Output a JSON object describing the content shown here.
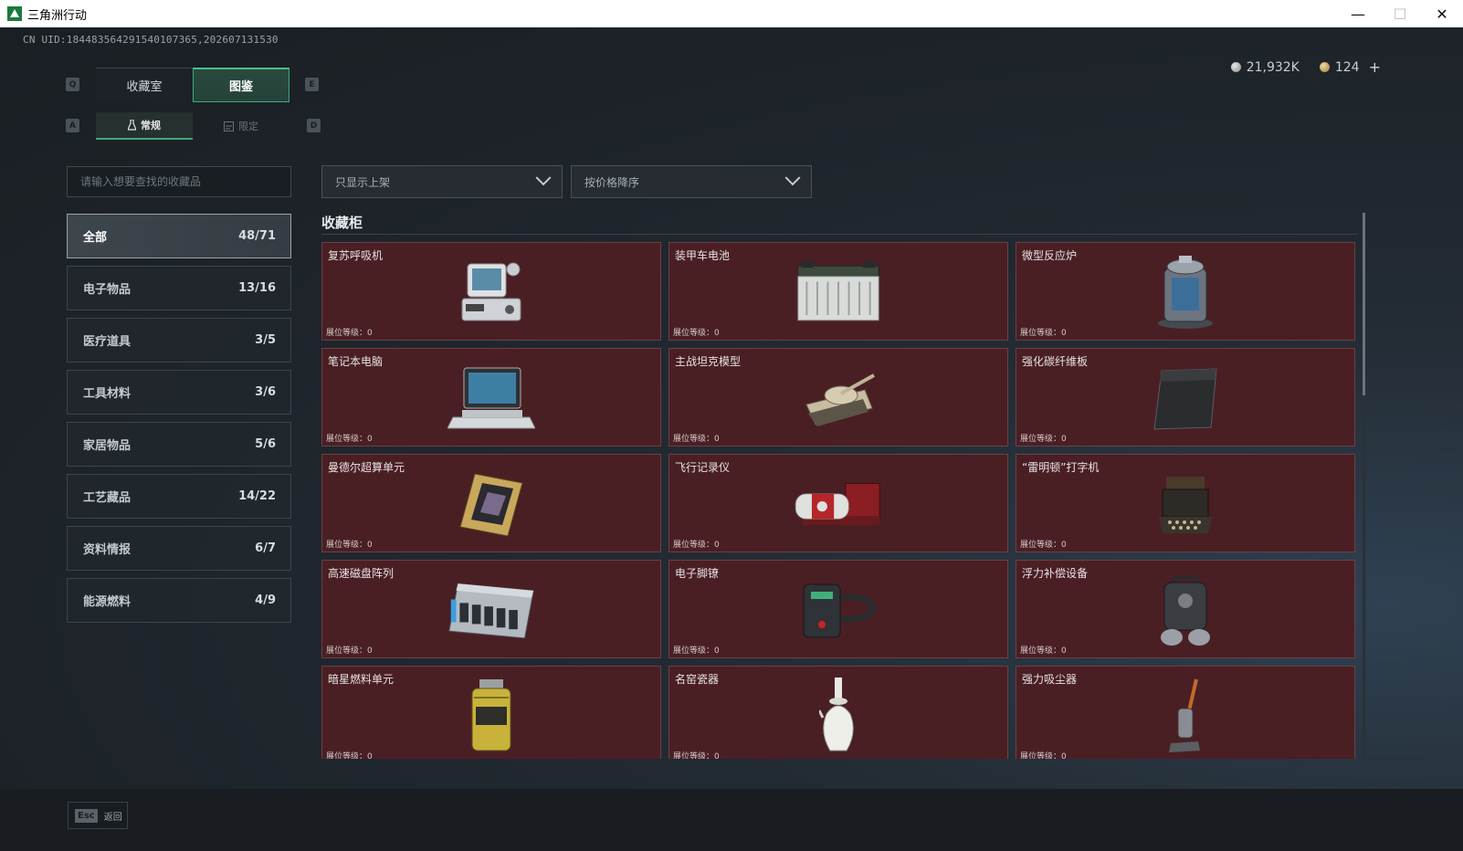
{
  "window": {
    "title": "三角洲行动",
    "minimize": "—",
    "maximize": "☐",
    "close": "✕"
  },
  "uid": "CN UID:18448356429154010736​5,202607131530",
  "currency": {
    "silver": "21,932K",
    "gold": "124",
    "add": "+"
  },
  "keys": {
    "prev_tab": "Q",
    "next_tab": "E",
    "prev_sub": "A",
    "next_sub": "D"
  },
  "tabs": [
    {
      "label": "收藏室",
      "active": false
    },
    {
      "label": "图鉴",
      "active": true
    }
  ],
  "subtabs": [
    {
      "label": "常规",
      "active": true
    },
    {
      "label": "限定",
      "active": false
    }
  ],
  "search": {
    "placeholder": "请输入想要查找的收藏品",
    "value": ""
  },
  "filters": {
    "display": "只显示上架",
    "sort": "按价格降序"
  },
  "categories": [
    {
      "label": "全部",
      "count": "48/71",
      "active": true
    },
    {
      "label": "电子物品",
      "count": "13/16",
      "active": false
    },
    {
      "label": "医疗道具",
      "count": "3/5",
      "active": false
    },
    {
      "label": "工具材料",
      "count": "3/6",
      "active": false
    },
    {
      "label": "家居物品",
      "count": "5/6",
      "active": false
    },
    {
      "label": "工艺藏品",
      "count": "14/22",
      "active": false
    },
    {
      "label": "资料情报",
      "count": "6/7",
      "active": false
    },
    {
      "label": "能源燃料",
      "count": "4/9",
      "active": false
    }
  ],
  "section_title": "收藏柜",
  "items": [
    {
      "name": "复苏呼吸机",
      "level": "展位等级：0",
      "icon": "ventilator-icon"
    },
    {
      "name": "装甲车电池",
      "level": "展位等级：0",
      "icon": "battery-icon"
    },
    {
      "name": "微型反应炉",
      "level": "展位等级：0",
      "icon": "reactor-icon"
    },
    {
      "name": "笔记本电脑",
      "level": "展位等级：0",
      "icon": "laptop-icon"
    },
    {
      "name": "主战坦克模型",
      "level": "展位等级：0",
      "icon": "tank-icon"
    },
    {
      "name": "强化碳纤维板",
      "level": "展位等级：0",
      "icon": "carbon-plate-icon"
    },
    {
      "name": "曼德尔超算单元",
      "level": "展位等级：0",
      "icon": "chip-icon"
    },
    {
      "name": "飞行记录仪",
      "level": "展位等级：0",
      "icon": "flight-recorder-icon"
    },
    {
      "name": "“雷明顿”打字机",
      "level": "展位等级：0",
      "icon": "typewriter-icon"
    },
    {
      "name": "高速磁盘阵列",
      "level": "展位等级：0",
      "icon": "disk-array-icon"
    },
    {
      "name": "电子脚镣",
      "level": "展位等级：0",
      "icon": "ankle-monitor-icon"
    },
    {
      "name": "浮力补偿设备",
      "level": "展位等级：0",
      "icon": "buoyancy-device-icon"
    },
    {
      "name": "暗星燃料单元",
      "level": "展位等级：0",
      "icon": "fuel-cell-icon"
    },
    {
      "name": "名窑瓷器",
      "level": "展位等级：0",
      "icon": "porcelain-vase-icon"
    },
    {
      "name": "强力吸尘器",
      "level": "展位等级：0",
      "icon": "vacuum-icon"
    }
  ],
  "bottom": {
    "esc_key": "Esc",
    "esc_label": "返回"
  }
}
